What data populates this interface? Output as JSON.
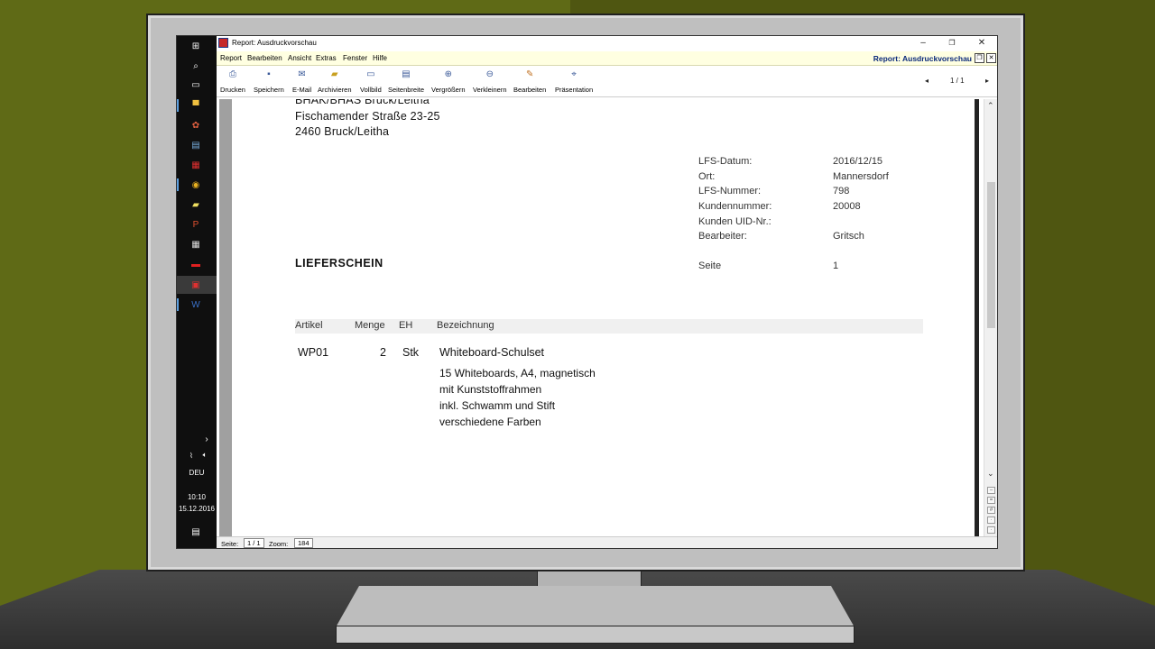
{
  "taskbar": {
    "language": "DEU",
    "time": "10:10",
    "date": "15.12.2016"
  },
  "window": {
    "title": "Report: Ausdruckvorschau",
    "minimize": "–",
    "restore": "❐",
    "close": "✕"
  },
  "menu": {
    "items": [
      "Report",
      "Bearbeiten",
      "Ansicht",
      "Extras",
      "Fenster",
      "Hilfe"
    ],
    "right_title": "Report: Ausdruckvorschau"
  },
  "toolbar": {
    "tools": [
      "Drucken",
      "Speichern",
      "E-Mail",
      "Archivieren",
      "Vollbild",
      "Seitenbreite",
      "Vergrößern",
      "Verkleinern",
      "Bearbeiten",
      "Präsentation"
    ],
    "page_indicator": "1 / 1"
  },
  "document": {
    "address": {
      "line1": "BHAK/BHAS Bruck/Leitha",
      "line2": "Fischamender Straße 23-25",
      "line3": "2460 Bruck/Leitha"
    },
    "meta": [
      {
        "label": "LFS-Datum:",
        "value": "2016/12/15"
      },
      {
        "label": "Ort:",
        "value": "Mannersdorf"
      },
      {
        "label": "LFS-Nummer:",
        "value": "798"
      },
      {
        "label": "Kundennummer:",
        "value": "20008"
      },
      {
        "label": "Kunden UID-Nr.:",
        "value": ""
      },
      {
        "label": "Bearbeiter:",
        "value": "Gritsch"
      }
    ],
    "title": "LIEFERSCHEIN",
    "page_label": "Seite",
    "page_value": "1",
    "table_headers": [
      "Artikel",
      "Menge",
      "EH",
      "Bezeichnung"
    ],
    "item": {
      "artikel": "WP01",
      "menge": "2",
      "eh": "Stk",
      "bezeichnung": "Whiteboard-Schulset",
      "description": [
        "15 Whiteboards, A4, magnetisch",
        "mit Kunststoffrahmen",
        "inkl. Schwamm und Stift",
        "verschiedene Farben"
      ]
    }
  },
  "status": {
    "page_label": "Seite:",
    "page_value": "1 / 1",
    "zoom_label": "Zoom:",
    "zoom_value": "184"
  }
}
